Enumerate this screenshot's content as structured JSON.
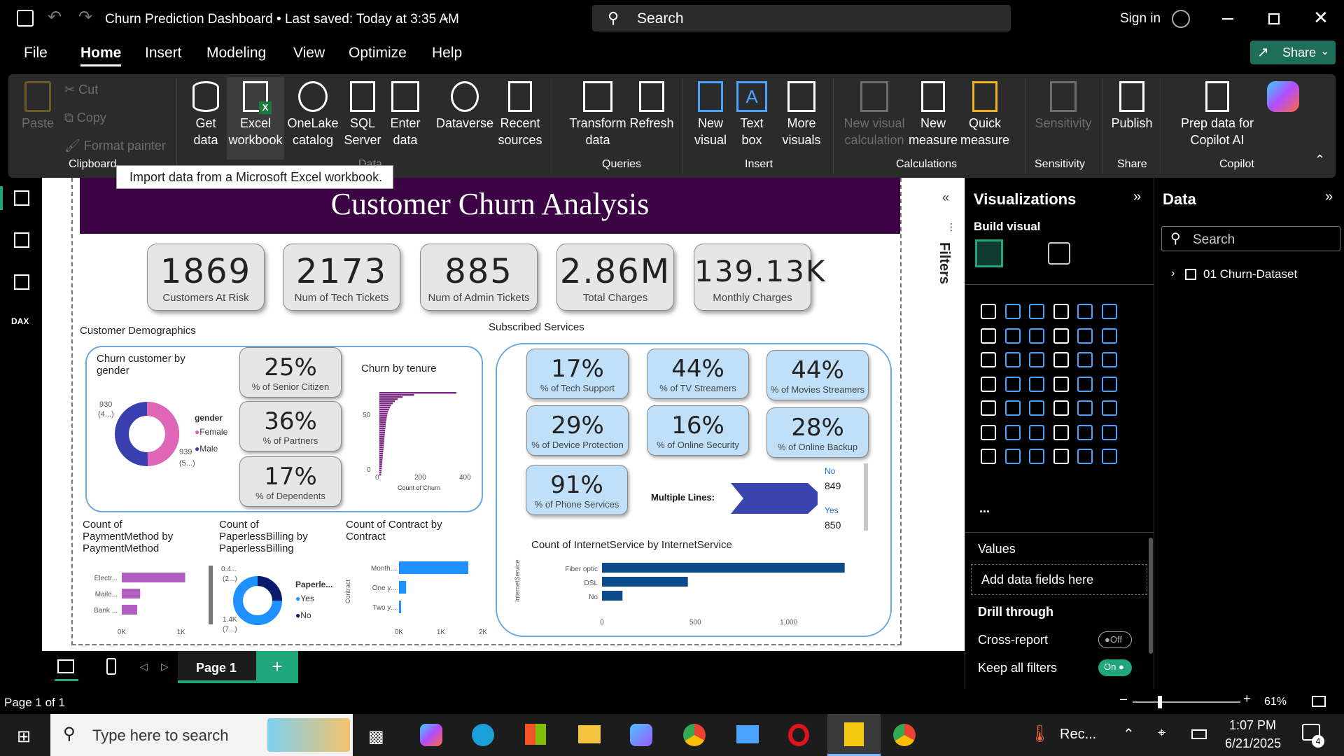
{
  "window": {
    "title": "Churn Prediction Dashboard • Last saved: Today at 3:35 AM",
    "search_placeholder": "Search",
    "sign_in": "Sign in"
  },
  "menu": [
    "File",
    "Home",
    "Insert",
    "Modeling",
    "View",
    "Optimize",
    "Help"
  ],
  "share": "Share",
  "ribbon": {
    "clipboard": {
      "paste": "Paste",
      "cut": "Cut",
      "copy": "Copy",
      "format_painter": "Format painter",
      "group": "Clipboard"
    },
    "data": {
      "get_data": "Get data",
      "excel": "Excel workbook",
      "onelake": "OneLake catalog",
      "sql": "SQL Server",
      "enter": "Enter data",
      "dataverse": "Dataverse",
      "recent": "Recent sources",
      "group": "Data"
    },
    "queries": {
      "transform": "Transform data",
      "refresh": "Refresh",
      "group": "Queries"
    },
    "insert": {
      "new_visual": "New visual",
      "text_box": "Text box",
      "more_visuals": "More visuals",
      "group": "Insert"
    },
    "calculations": {
      "new_visual_calc": "New visual calculation",
      "new_measure": "New measure",
      "quick_measure": "Quick measure",
      "group": "Calculations"
    },
    "sensitivity": {
      "label": "Sensitivity",
      "group": "Sensitivity"
    },
    "share": {
      "publish": "Publish",
      "group": "Share"
    },
    "copilot": {
      "prep": "Prep data for Copilot AI",
      "group": "Copilot"
    }
  },
  "tooltip": "Import data from a Microsoft Excel workbook.",
  "report": {
    "title": "Customer Churn Analysis",
    "kpis": [
      {
        "value": "1869",
        "label": "Customers At Risk"
      },
      {
        "value": "2173",
        "label": "Num of Tech Tickets"
      },
      {
        "value": "885",
        "label": "Num of Admin Tickets"
      },
      {
        "value": "2.86M",
        "label": "Total Charges"
      },
      {
        "value": "139.13K",
        "label": "Monthly Charges"
      }
    ],
    "demographics_title": "Customer Demographics",
    "services_title": "Subscribed Services",
    "gender_chart_title": "Churn customer by gender",
    "gender_labels": {
      "top": "930",
      "top_pct": "(4...)",
      "bottom": "939",
      "bottom_pct": "(5...)"
    },
    "gender_legend": {
      "title": "gender",
      "female": "Female",
      "male": "Male"
    },
    "demo_pcts": [
      {
        "value": "25%",
        "label": "% of Senior Citizen"
      },
      {
        "value": "36%",
        "label": "% of Partners"
      },
      {
        "value": "17%",
        "label": "% of Dependents"
      }
    ],
    "tenure_title": "Churn by tenure",
    "tenure_axis": {
      "y50": "50",
      "y0": "0",
      "x0": "0",
      "x200": "200",
      "x400": "400",
      "xlabel": "Count of Churn"
    },
    "service_pcts": [
      {
        "value": "17%",
        "label": "% of Tech Support"
      },
      {
        "value": "44%",
        "label": "% of TV Streamers"
      },
      {
        "value": "44%",
        "label": "% of Movies Streamers"
      },
      {
        "value": "29%",
        "label": "% of Device Protection"
      },
      {
        "value": "16%",
        "label": "% of Online Security"
      },
      {
        "value": "28%",
        "label": "% of Online Backup"
      },
      {
        "value": "91%",
        "label": "% of Phone Services"
      }
    ],
    "multiple_lines": {
      "label": "Multiple Lines:",
      "no": "No",
      "no_val": "849",
      "yes": "Yes",
      "yes_val": "850"
    },
    "payment_title": "Count of PaymentMethod by PaymentMethod",
    "payment_cats": [
      "Electr...",
      "Maile...",
      "Bank ..."
    ],
    "payment_ticks": [
      "0K",
      "1K"
    ],
    "paperless_title": "Count of PaperlessBilling by PaperlessBilling",
    "paperless_labels": {
      "top": "0.4...",
      "top_pct": "(2...)",
      "bottom": "1.4K",
      "bottom_pct": "(7...)"
    },
    "paperless_legend": {
      "title": "Paperle...",
      "yes": "Yes",
      "no": "No"
    },
    "contract_title": "Count of Contract by Contract",
    "contract_cats": [
      "Month...",
      "One y...",
      "Two y..."
    ],
    "contract_ticks": [
      "0K",
      "1K",
      "2K"
    ],
    "contract_axis": "Contract",
    "internet_title": "Count of InternetService by InternetService",
    "internet_axis": "InternetService",
    "internet_ticks": [
      "0",
      "500",
      "1,000"
    ]
  },
  "chart_data": [
    {
      "type": "pie",
      "title": "Churn customer by gender",
      "categories": [
        "Female",
        "Male"
      ],
      "values": [
        930,
        939
      ],
      "colors": [
        "#e066b8",
        "#3a3fb0"
      ]
    },
    {
      "type": "bar",
      "title": "Churn by tenure",
      "xlabel": "Count of Churn",
      "xlim": [
        0,
        400
      ],
      "ylim": [
        0,
        60
      ],
      "values": [
        400,
        180,
        120,
        95,
        80,
        70,
        60,
        55,
        50,
        45,
        42,
        40,
        38,
        36,
        34,
        33,
        32,
        31,
        30,
        29,
        28,
        27,
        26,
        25,
        24,
        23,
        22,
        21,
        20,
        19,
        18,
        17,
        16,
        15,
        14,
        13,
        12,
        11,
        10,
        9
      ]
    },
    {
      "type": "bar",
      "title": "Count of PaymentMethod by PaymentMethod",
      "categories": [
        "Electr...",
        "Maile...",
        "Bank ..."
      ],
      "values": [
        1070,
        310,
        260
      ],
      "xlim": [
        0,
        1300
      ]
    },
    {
      "type": "pie",
      "title": "Count of PaperlessBilling by PaperlessBilling",
      "categories": [
        "Yes",
        "No"
      ],
      "values": [
        1400,
        470
      ],
      "colors": [
        "#1e90ff",
        "#0a1a6e"
      ]
    },
    {
      "type": "bar",
      "title": "Count of Contract by Contract",
      "categories": [
        "Month...",
        "One y...",
        "Two y..."
      ],
      "values": [
        1650,
        170,
        50
      ],
      "xlim": [
        0,
        2200
      ]
    },
    {
      "type": "bar",
      "title": "Count of InternetService by InternetService",
      "categories": [
        "Fiber optic",
        "DSL",
        "No"
      ],
      "values": [
        1300,
        460,
        110
      ],
      "xlim": [
        0,
        1350
      ]
    }
  ],
  "filters_label": "Filters",
  "viz": {
    "title": "Visualizations",
    "build": "Build visual",
    "values": "Values",
    "add_fields": "Add data fields here",
    "drill": "Drill through",
    "cross": "Cross-report",
    "cross_state": "Off",
    "keep": "Keep all filters",
    "keep_state": "On",
    "more": "..."
  },
  "data_pane": {
    "title": "Data",
    "search": "Search",
    "dataset": "01 Churn-Dataset"
  },
  "page": {
    "tab": "Page 1",
    "status": "Page 1 of 1",
    "zoom": "61%"
  },
  "taskbar": {
    "search": "Type here to search",
    "rec": "Rec...",
    "time": "1:07 PM",
    "date": "6/21/2025",
    "notif": "4"
  }
}
